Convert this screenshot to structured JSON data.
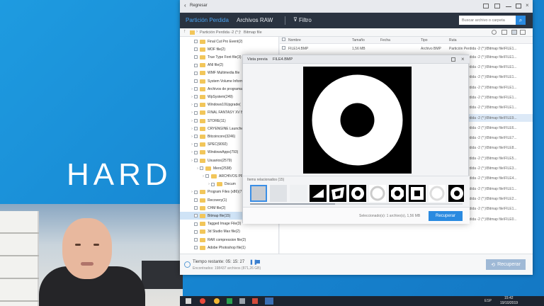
{
  "brand_text": "HARD",
  "window": {
    "back_label": "Regresar",
    "tabs": [
      "Partición Perdida",
      "Archivos RAW"
    ],
    "filter_label": "Filtro",
    "search_placeholder": "Buscar archivo o carpeta",
    "breadcrumb": [
      "Partición Perdida -2 (*:)",
      "Bitmap file"
    ]
  },
  "tree": [
    {
      "label": "Final Cut Pro Event(2)",
      "sel": false,
      "exp": false
    },
    {
      "label": "MOF file(2)",
      "sel": false,
      "exp": false
    },
    {
      "label": "True Type Font file(3)",
      "sel": false,
      "exp": false
    },
    {
      "label": "ANI file(2)",
      "sel": false,
      "exp": false
    },
    {
      "label": "WMF Multimedia file",
      "sel": false,
      "exp": false
    },
    {
      "label": "System Volume Inform",
      "sel": false,
      "exp": false
    },
    {
      "label": "Archivos de programa",
      "sel": false,
      "exp": true
    },
    {
      "label": "WpSystem(249)",
      "sel": false,
      "exp": true
    },
    {
      "label": "Windows10Upgrade(",
      "sel": false,
      "exp": true
    },
    {
      "label": "FINAL FANTASY XV BE",
      "sel": false,
      "exp": true
    },
    {
      "label": "STORE(11)",
      "sel": false,
      "exp": true
    },
    {
      "label": "CRYENGINE Launche",
      "sel": false,
      "exp": true
    },
    {
      "label": "Bitcoincore(3246)",
      "sel": false,
      "exp": true
    },
    {
      "label": "SPEC(9092)",
      "sel": false,
      "exp": true
    },
    {
      "label": "WindowsApps(793)",
      "sel": false,
      "exp": true
    },
    {
      "label": "Usuarios(2579)",
      "sel": false,
      "exp": true
    },
    {
      "label": "Mero(2538)",
      "sel": false,
      "exp": true
    },
    {
      "label": "ARCHIVOS PR",
      "sel": false,
      "exp": true
    },
    {
      "label": "Docum",
      "sel": false,
      "exp": true
    },
    {
      "label": "Program Files (x86)(7",
      "sel": false,
      "exp": true
    },
    {
      "label": "Recovery(1)",
      "sel": false,
      "exp": false
    },
    {
      "label": "CHM file(2)",
      "sel": false,
      "exp": false
    },
    {
      "label": "Bitmap file(15)",
      "sel": true,
      "exp": false
    },
    {
      "label": "Tagged Image File(3)",
      "sel": false,
      "exp": false
    },
    {
      "label": "3d Studio Max file(2)",
      "sel": false,
      "exp": false
    },
    {
      "label": "RAR compression file(2)",
      "sel": false,
      "exp": false
    },
    {
      "label": "Adobe Photoshop file(1)",
      "sel": false,
      "exp": false
    }
  ],
  "list_headers": [
    "Nombre",
    "Tamaño",
    "Fecha",
    "Tipo",
    "Ruta"
  ],
  "list_first_row": {
    "name": "FILE14.BMP",
    "size": "1,56 MB",
    "type": "Archivo BMP",
    "path": "Partición Perdida -2 (*:)\\Bitmap file\\FILE1..."
  },
  "list_paths": [
    "Partición Perdida -2 (*:)\\Bitmap file\\FILE1...",
    "Partición Perdida -2 (*:)\\Bitmap file\\FILE1...",
    "Partición Perdida -2 (*:)\\Bitmap file\\FILE1...",
    "Partición Perdida -2 (*:)\\Bitmap file\\FILE1...",
    "Partición Perdida -2 (*:)\\Bitmap file\\FILE1...",
    "Partición Perdida -2 (*:)\\Bitmap file\\FILE1...",
    "Partición Perdida -2 (*:)\\Bitmap file\\FILE9...",
    "Partición Perdida -2 (*:)\\Bitmap file\\FILE6...",
    "Partición Perdida -2 (*:)\\Bitmap file\\FILE7...",
    "Partición Perdida -2 (*:)\\Bitmap file\\FILE8...",
    "Partición Perdida -2 (*:)\\Bitmap file\\FILE5...",
    "Partición Perdida -2 (*:)\\Bitmap file\\FILE3...",
    "Partición Perdida -2 (*:)\\Bitmap file\\FILE4...",
    "Partición Perdida -2 (*:)\\Bitmap file\\FILE1...",
    "Partición Perdida -2 (*:)\\Bitmap file\\FILE2...",
    "Partición Perdida -2 (*:)\\Bitmap file\\FILE1...",
    "Partición Perdida -2 (*:)\\Bitmap file\\FILE0..."
  ],
  "preview": {
    "title": "Vista previa",
    "filename": "FILE4.BMP",
    "related_label": "Items relacionados (15)",
    "selected_text": "Seleccionado(s): 1 archivo(s), 1,56 MB",
    "recover_label": "Recuperar"
  },
  "status": {
    "time_left": "Tiempo restante: 05: 15: 27",
    "found": "Encontrados: 198437 archivos (871,26 GB)",
    "recover_label": "Recuperar"
  },
  "taskbar": {
    "time": "15:42",
    "date": "19/10/2019",
    "lang": "ESP"
  }
}
